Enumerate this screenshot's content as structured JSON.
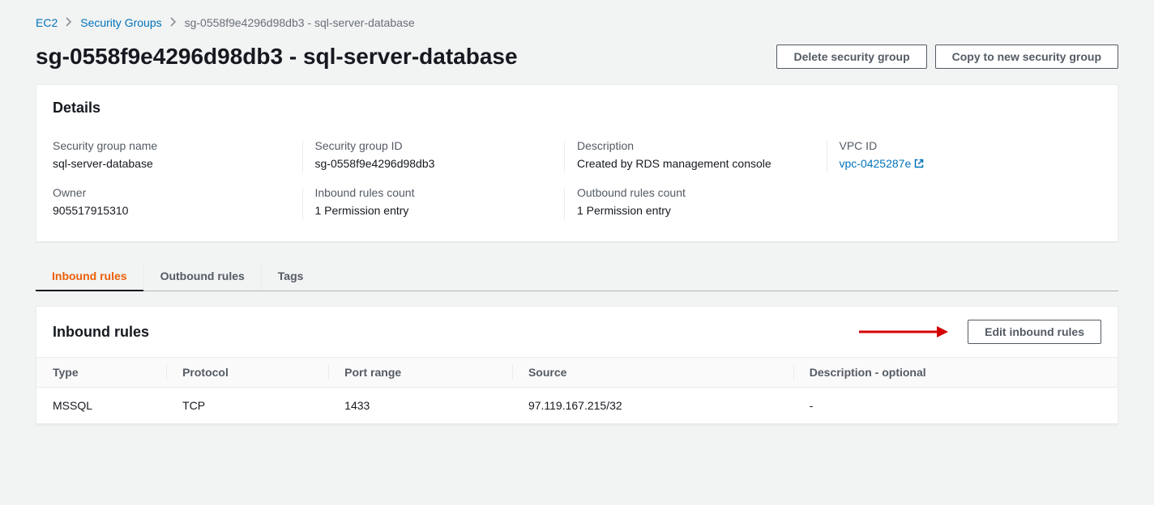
{
  "breadcrumb": {
    "root": "EC2",
    "group": "Security Groups",
    "current": "sg-0558f9e4296d98db3 - sql-server-database"
  },
  "header": {
    "title": "sg-0558f9e4296d98db3 - sql-server-database",
    "delete_button": "Delete security group",
    "copy_button": "Copy to new security group"
  },
  "details": {
    "panel_title": "Details",
    "name_label": "Security group name",
    "name_value": "sql-server-database",
    "id_label": "Security group ID",
    "id_value": "sg-0558f9e4296d98db3",
    "desc_label": "Description",
    "desc_value": "Created by RDS management console",
    "vpc_label": "VPC ID",
    "vpc_value": "vpc-0425287e",
    "owner_label": "Owner",
    "owner_value": "905517915310",
    "inbound_count_label": "Inbound rules count",
    "inbound_count_value": "1 Permission entry",
    "outbound_count_label": "Outbound rules count",
    "outbound_count_value": "1 Permission entry"
  },
  "tabs": {
    "inbound": "Inbound rules",
    "outbound": "Outbound rules",
    "tags": "Tags"
  },
  "rules": {
    "panel_title": "Inbound rules",
    "edit_button": "Edit inbound rules",
    "columns": {
      "type": "Type",
      "protocol": "Protocol",
      "port": "Port range",
      "source": "Source",
      "description": "Description - optional"
    },
    "rows": [
      {
        "type": "MSSQL",
        "protocol": "TCP",
        "port": "1433",
        "source": "97.119.167.215/32",
        "description": "-"
      }
    ]
  }
}
